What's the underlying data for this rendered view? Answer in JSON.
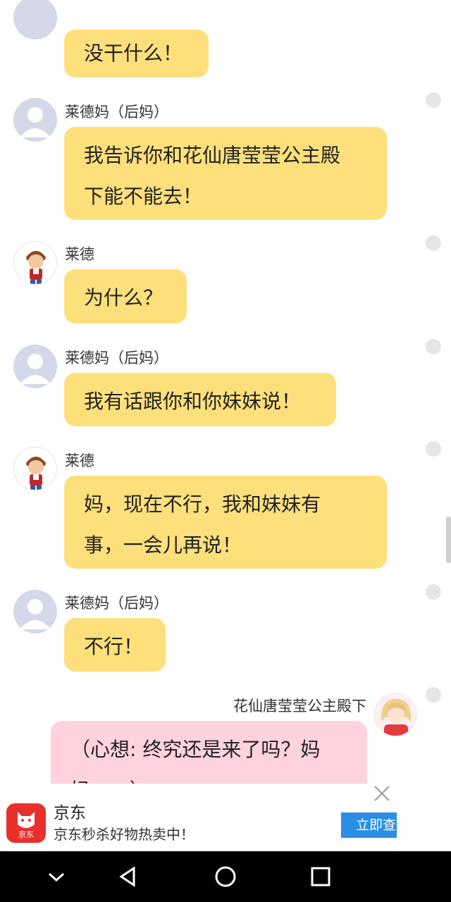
{
  "messages": [
    {
      "text": "没干什么！"
    },
    {
      "sender": "莱德妈（后妈）",
      "line1": "我告诉你和花仙唐莹莹公主殿",
      "line2": "下能不能去！"
    },
    {
      "sender": "莱德",
      "text": "为什么？"
    },
    {
      "sender": "莱德妈（后妈）",
      "text": "我有话跟你和你妹妹说！"
    },
    {
      "sender": "莱德",
      "line1": "妈，现在不行，我和妹妹有",
      "line2": "事，一会儿再说！"
    },
    {
      "sender": "莱德妈（后妈）",
      "text": "不行！"
    },
    {
      "sender": "花仙唐莹莹公主殿下",
      "line1": "（心想: 终究还是来了吗？妈",
      "line2": "妈……）"
    }
  ],
  "ad": {
    "logo_text": "京东",
    "title": "京东",
    "description": "京东秒杀好物热卖中！",
    "cta": "立即查看"
  },
  "nav": {
    "icons": [
      "chevron-down-icon",
      "back-triangle-icon",
      "home-circle-icon",
      "recents-square-icon"
    ]
  },
  "colors": {
    "bubble_yellow": "#fde07c",
    "bubble_pink": "#ffd3de",
    "ad_cta": "#2a8ee5",
    "jd_red": "#e8312c"
  }
}
